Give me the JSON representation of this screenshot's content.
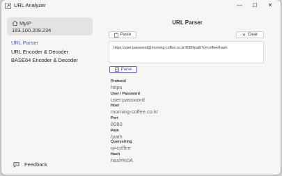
{
  "window": {
    "title": "URL Analyzer",
    "minimize": "—",
    "maximize": "☐",
    "close": "✕"
  },
  "sidebar": {
    "ip_label": "MyIP",
    "ip_value": "183.100.209.234",
    "items": [
      {
        "label": "URL Parser",
        "active": true
      },
      {
        "label": "URL Encoder & Decoder",
        "active": false
      },
      {
        "label": "BASE64 Encoder & Decoder",
        "active": false
      }
    ],
    "feedback_label": "Feedback"
  },
  "main": {
    "title": "URL Parser",
    "paste_label": "Paste",
    "clear_label": "Clear",
    "url_value": "https://user:password@morning-coffee.co.kr:8080/path?q=coffee#hash",
    "parse_label": "Parse",
    "fields": [
      {
        "label": "Protocol",
        "value": "https"
      },
      {
        "label": "User / Password",
        "value": "user:password"
      },
      {
        "label": "Host",
        "value": "morning-coffee.co.kr"
      },
      {
        "label": "Port",
        "value": "8080"
      },
      {
        "label": "Path",
        "value": "/path"
      },
      {
        "label": "Querystring",
        "value": "q=coffee"
      },
      {
        "label": "Hash",
        "value": "hash%0A"
      }
    ]
  },
  "colors": {
    "accent": "#4b5cc9",
    "background": "#f7f6f4",
    "card": "#e3e3e3"
  }
}
